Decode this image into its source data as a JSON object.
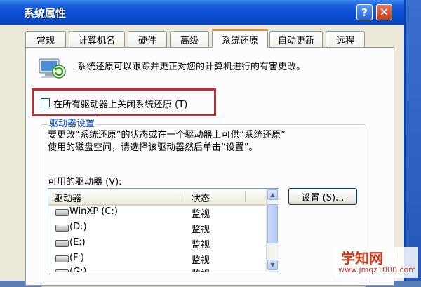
{
  "window": {
    "title": "系统属性",
    "help_label": "?",
    "close_label": "✕"
  },
  "tabs": [
    {
      "label": "常规"
    },
    {
      "label": "计算机名"
    },
    {
      "label": "硬件"
    },
    {
      "label": "高级"
    },
    {
      "label": "系统还原",
      "active": true
    },
    {
      "label": "自动更新"
    },
    {
      "label": "远程"
    }
  ],
  "intro_text": "系统还原可以跟踪并更正对您的计算机进行的有害更改。",
  "disable_checkbox": {
    "label": "在所有驱动器上关闭系统还原 (T)",
    "checked": false
  },
  "drive_settings": {
    "legend": "驱动器设置",
    "description_line1": "要更改“系统还原”的状态或在一个驱动器上可供“系统还原”",
    "description_line2": "使用的磁盘空间，请选择该驱动器然后单击“设置”。",
    "available_label": "可用的驱动器 (V):",
    "columns": [
      "驱动器",
      "状态"
    ],
    "drives": [
      {
        "name": "WinXP  (C:)",
        "status": "监视"
      },
      {
        "name": "(D:)",
        "status": "监视"
      },
      {
        "name": "(E:)",
        "status": "监视"
      },
      {
        "name": "(F:)",
        "status": "监视"
      },
      {
        "name": "(G:)",
        "status": "监视"
      }
    ],
    "settings_button": "设置 (S)..."
  },
  "watermark": {
    "brand": "学知网",
    "url": "www.jmqz1000.com"
  },
  "colors": {
    "title_bar": "#0b4fd4",
    "dialog_bg": "#ece9d8",
    "highlight_border": "#d0232a",
    "group_legend": "#0046d5",
    "active_tab_accent": "#e68b2c"
  },
  "icons": {
    "restore": "system-restore-icon",
    "drive": "hard-drive-icon"
  }
}
